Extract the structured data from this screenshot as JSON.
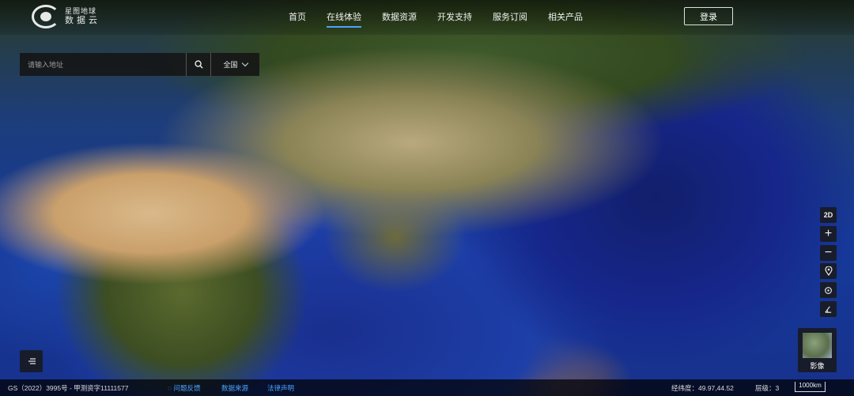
{
  "app": {
    "logo_line1": "星图地球",
    "logo_line2": "数据云"
  },
  "nav": {
    "items": [
      {
        "label": "首页"
      },
      {
        "label": "在线体验",
        "active": true
      },
      {
        "label": "数据资源"
      },
      {
        "label": "开发支持"
      },
      {
        "label": "服务订阅"
      },
      {
        "label": "相关产品"
      }
    ],
    "login_label": "登录"
  },
  "search": {
    "placeholder": "请输入地址",
    "region_label": "全国"
  },
  "controls": {
    "view_mode_label": "2D",
    "zoom_in_label": "+",
    "zoom_out_label": "−",
    "layer_label": "影像"
  },
  "footer": {
    "gs_text": "GS（2022）3995号 - 甲测资字11111577",
    "feedback_label": "问题反馈",
    "source_label": "数据来源",
    "legal_label": "法律声明",
    "coords_text": "经纬度：49.97,44.52",
    "level_text": "层级：3",
    "scale_text": "1000km"
  },
  "colors": {
    "accent": "#4ea1ff",
    "link": "#4aa3ff"
  }
}
